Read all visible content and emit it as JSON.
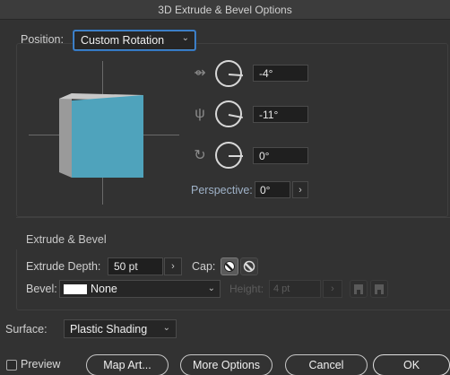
{
  "window": {
    "title": "3D Extrude & Bevel Options"
  },
  "position": {
    "label": "Position:",
    "value": "Custom Rotation",
    "icon": "chevron-down-icon"
  },
  "rotation": {
    "x": {
      "value": "-4°",
      "icon": "rotate-x-icon",
      "angle": -4
    },
    "y": {
      "value": "-11°",
      "icon": "rotate-y-icon",
      "angle": -11
    },
    "z": {
      "value": "0°",
      "icon": "rotate-z-icon",
      "angle": 0
    }
  },
  "perspective": {
    "label": "Perspective:",
    "value": "0°"
  },
  "extrude_bevel": {
    "title": "Extrude & Bevel",
    "extrude_depth_label": "Extrude Depth:",
    "extrude_depth_value": "50 pt",
    "cap_label": "Cap:",
    "bevel_label": "Bevel:",
    "bevel_value": "None",
    "height_label": "Height:",
    "height_value": "4 pt"
  },
  "surface": {
    "label": "Surface:",
    "value": "Plastic Shading"
  },
  "footer": {
    "preview_label": "Preview",
    "map_art_label": "Map Art...",
    "more_options_label": "More Options",
    "cancel_label": "Cancel",
    "ok_label": "OK"
  },
  "colors": {
    "cube_front": "#4fa3bc",
    "accent": "#4a8fd8",
    "background": "#323232"
  }
}
